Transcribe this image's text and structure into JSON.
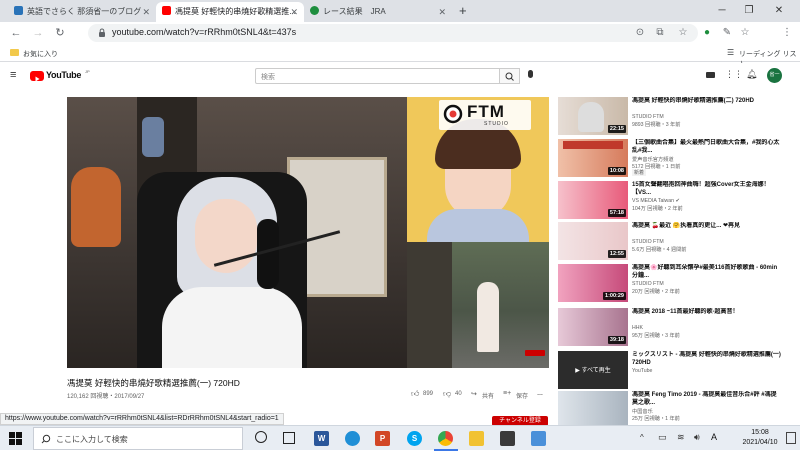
{
  "browser": {
    "tabs": [
      {
        "title": "英語でさらく 那須省一のブログ",
        "active": false,
        "favicon_color": "#2a73b8"
      },
      {
        "title": "馮提莫 好輕快的串燒好歌精選推...",
        "active": true,
        "favicon_color": "#ff0000"
      },
      {
        "title": "レース結果　JRA",
        "active": false,
        "favicon_color": "#1e8e3e"
      }
    ],
    "new_tab": "+",
    "url": "youtube.com/watch?v=rRRhm0tSNL4&t=437s",
    "bookmark_folder": "お気に入り",
    "reading_list": "リーディング リスト",
    "profile_initial": "省一"
  },
  "youtube": {
    "logo_text": "YouTube",
    "logo_suffix": "JP",
    "search_placeholder": "検索",
    "avatar_initial": "省一"
  },
  "video": {
    "title": "馮提莫 好輕快的串燒好歌精選推薦(一) 720HD",
    "meta": "120,162 回視聴・2017/09/27",
    "likes": "899",
    "dislikes": "40",
    "share_label": "共有",
    "save_label": "保存",
    "more_label": "…",
    "overlay_logo": "FTM",
    "overlay_sub": "STUDIO"
  },
  "sidebar": [
    {
      "title": "馮提莫 好輕快的串燒好歌精選推薦(二) 720HD",
      "channel": "STUDIO FTM",
      "meta": "9893 回視聴・3 年前",
      "duration": "22:15",
      "thumb": "#c9b9a8"
    },
    {
      "title": "【三個歌曲合集】最火最熱門日歌曲大合集，#我的心太乱#我...",
      "channel": "爱声音乐官方頻道",
      "meta": "5172 回視聴・1 日前",
      "duration": "10:08",
      "badge": "新着",
      "thumb": "#d67b5c"
    },
    {
      "title": "15首女聲翻唱抱回神曲嗨！超強Cover女王金海娜！【VS...",
      "channel": "VS MEDIA Taiwan ✔",
      "meta": "104万 回視聴・2 年前",
      "duration": "57:18",
      "thumb": "#e85a7a"
    },
    {
      "title": "馮提莫 🍒最近 🤗执着真的更让... ❤再見",
      "channel": "STUDIO FTM",
      "meta": "5.6万 回視聴・4 週間前",
      "duration": "12:55",
      "thumb": "#e9c7c9"
    },
    {
      "title": "馮提莫🌸好聽到耳朵懷孕#最美116首好歌歌曲 - 60min分鐘...",
      "channel": "STUDIO FTM",
      "meta": "20万 回視聴・2 年前",
      "duration": "1:00:29",
      "thumb": "#c64a7a"
    },
    {
      "title": "馮提莫 2018 ~11首最好聽的歌-超高音！",
      "channel": "HHK",
      "meta": "95万 回視聴・3 年前",
      "duration": "39:18",
      "thumb": "#a8748f"
    },
    {
      "title": "ミックスリスト - 馮提莫 好輕快的串燒好歌精選推薦(一) 720HD",
      "channel": "YouTube",
      "meta": "",
      "duration": "",
      "mix_label": "すべて再生",
      "thumb": "#2c2c2c"
    },
    {
      "title": "馮提莫 Feng Timo 2019 - 馮提莫最佳音乐合#評 #馮提莫之歌...",
      "channel": "中国音乐",
      "meta": "25万 回視聴・1 年前",
      "duration": "",
      "thumb": "#a9b4bf"
    }
  ],
  "status_url": "https://www.youtube.com/watch?v=rRRhm0tSNL4&list=RDrRRhm0tSNL4&start_radio=1",
  "subscribe_label": "チャンネル登録",
  "taskbar": {
    "search_placeholder": "ここに入力して検索",
    "time": "15:08",
    "date": "2021/04/10",
    "ime": "A"
  }
}
